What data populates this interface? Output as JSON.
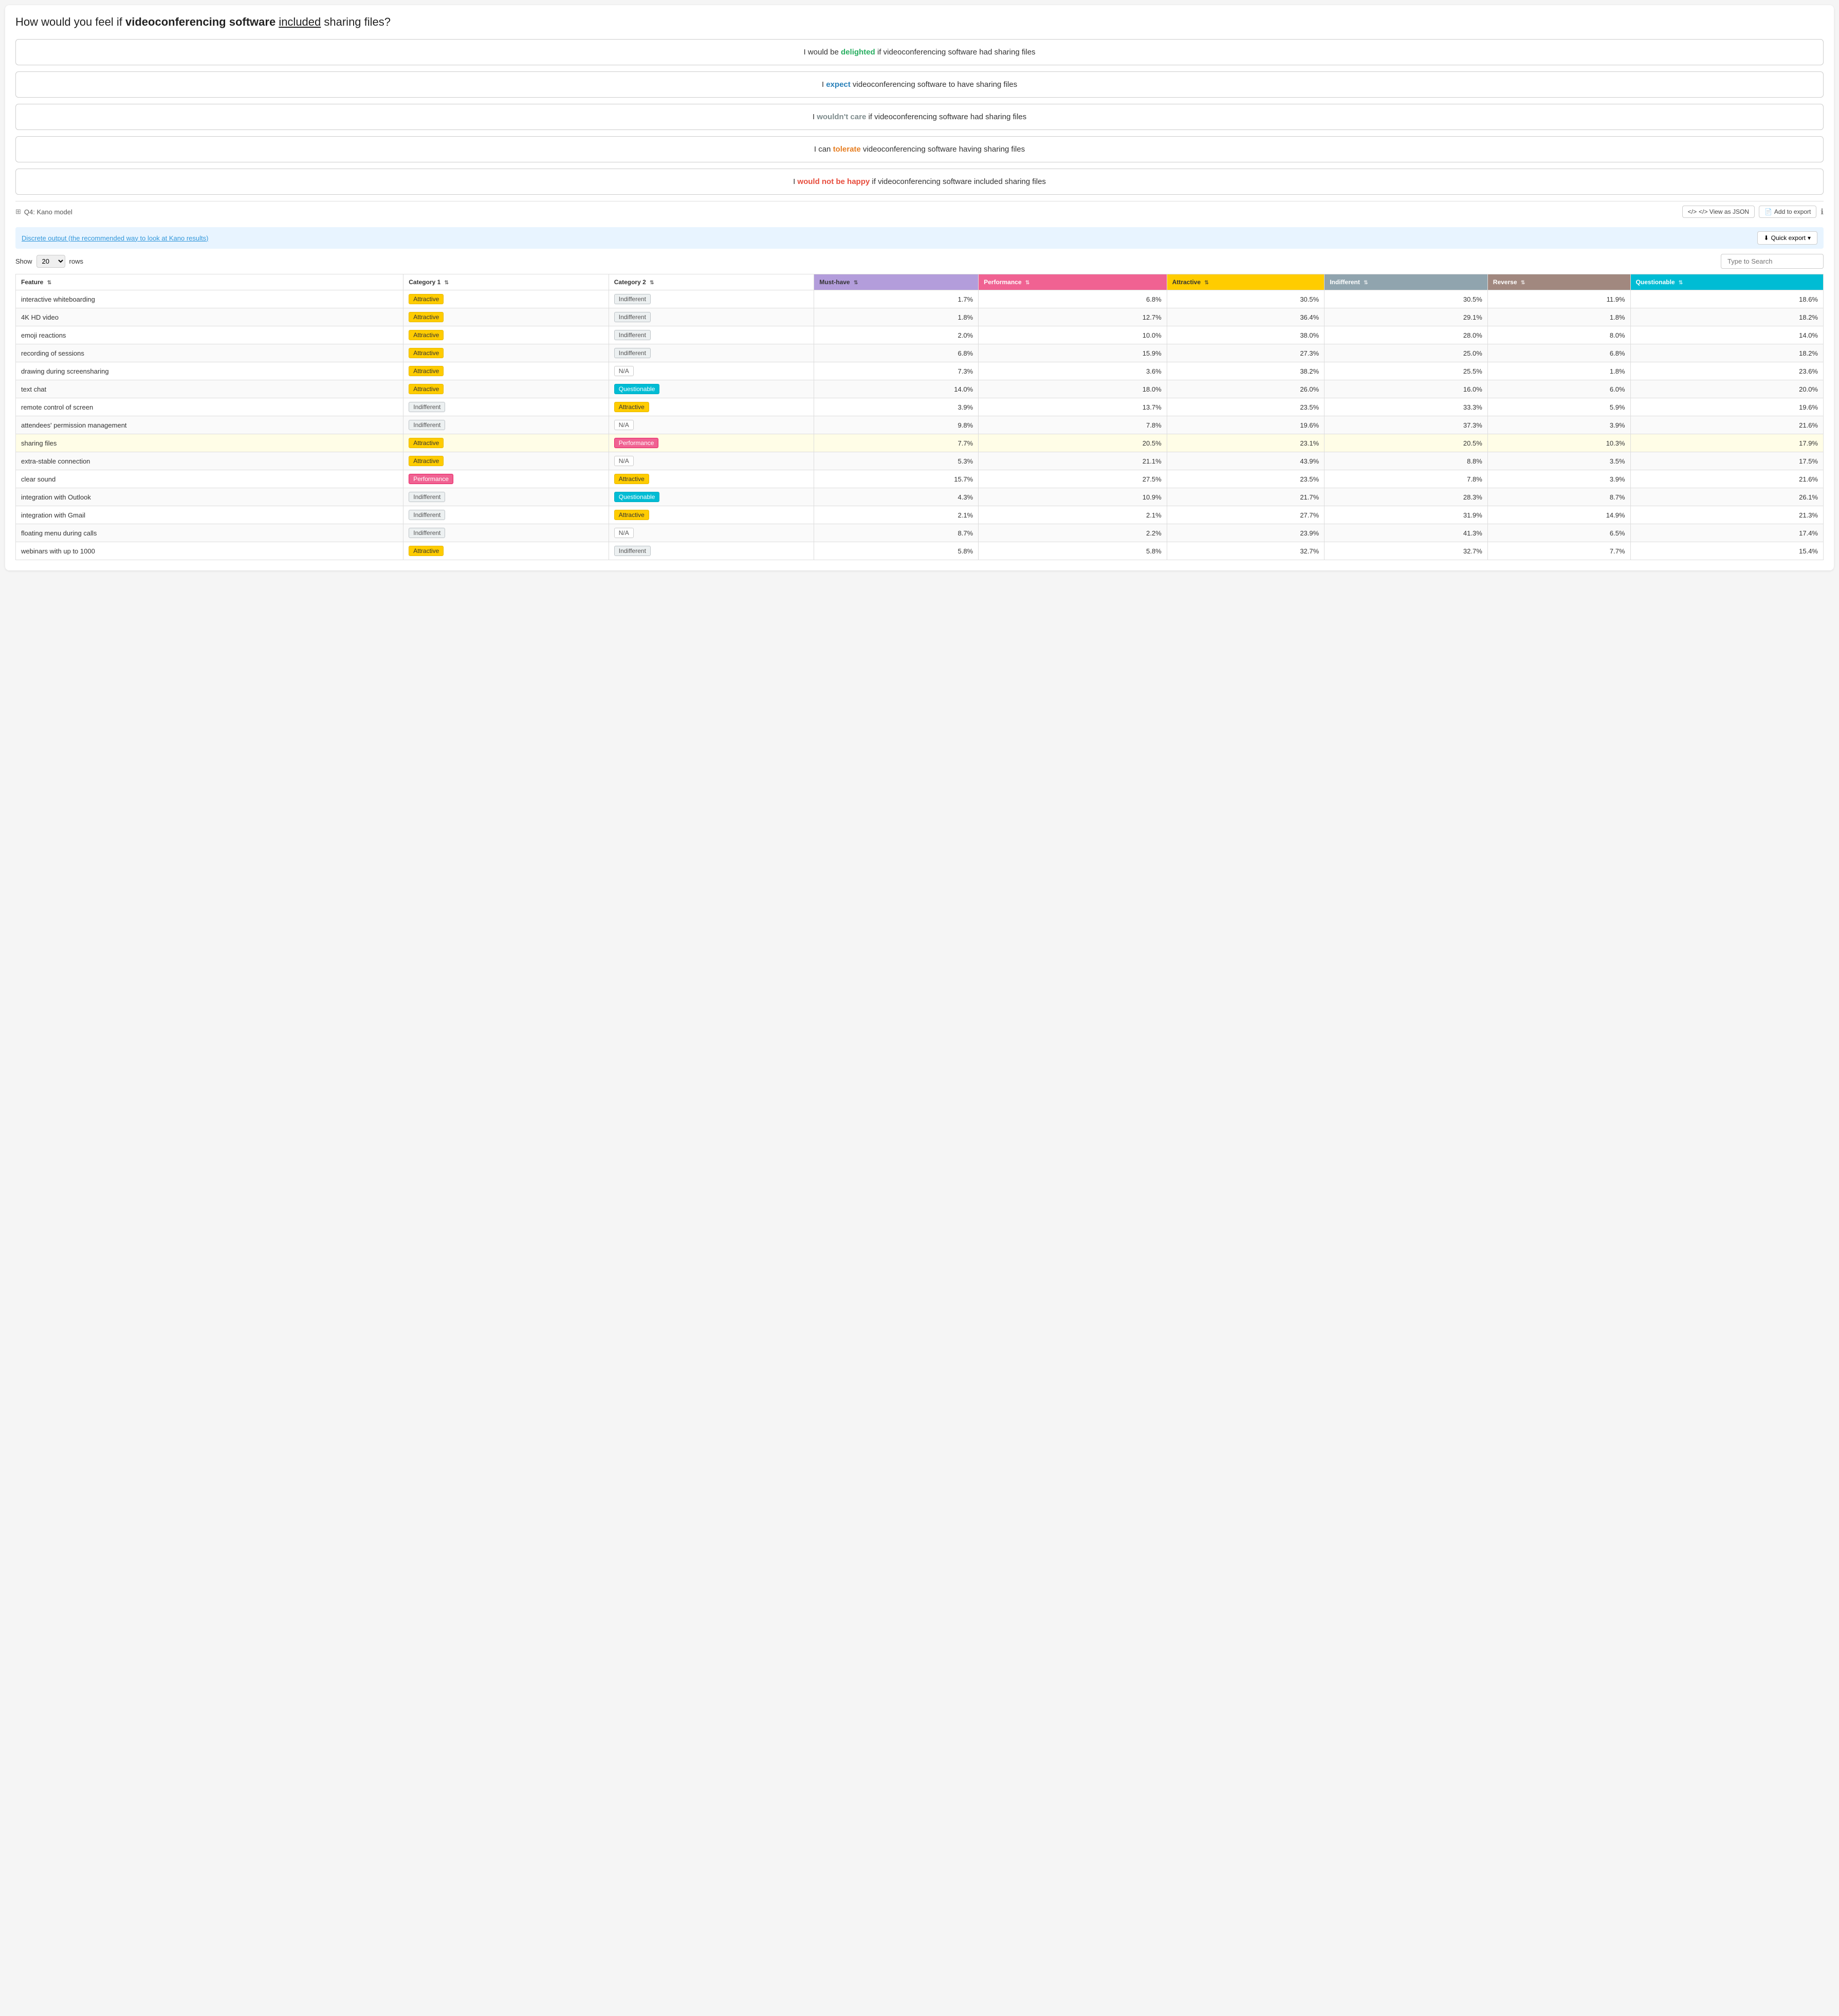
{
  "question": {
    "text_before": "How would you feel if ",
    "bold_part": "videoconferencing software",
    "middle": " ",
    "underlined": "included",
    "after": " sharing files?"
  },
  "answers": [
    {
      "id": "delighted",
      "text_before": "I would be ",
      "colored": "delighted",
      "color_class": "color-green",
      "text_after": " if videoconferencing software had sharing files"
    },
    {
      "id": "expect",
      "text_before": "I ",
      "colored": "expect",
      "color_class": "color-blue",
      "text_after": " videoconferencing software to have sharing files"
    },
    {
      "id": "wouldnt_care",
      "text_before": "I ",
      "colored": "wouldn't care",
      "color_class": "color-gray",
      "text_after": " if videoconferencing software had sharing files"
    },
    {
      "id": "tolerate",
      "text_before": "I can ",
      "colored": "tolerate",
      "color_class": "color-orange",
      "text_after": " videoconferencing software having sharing files"
    },
    {
      "id": "not_happy",
      "text_before": "I ",
      "colored": "would not be happy",
      "color_class": "color-red",
      "text_after": " if videoconferencing software included sharing files"
    }
  ],
  "kano_section": {
    "title": "Q4: Kano model",
    "view_json_label": "</> View as JSON",
    "add_export_label": "Add to export",
    "info_icon": "ℹ",
    "discrete_text": "Discrete output (the recommended way to look at Kano results)",
    "quick_export_label": "⬇ Quick export ▾"
  },
  "table_controls": {
    "show_label": "Show",
    "rows_label": "rows",
    "show_value": "20",
    "search_placeholder": "Type to Search"
  },
  "table": {
    "headers": [
      {
        "id": "feature",
        "label": "Feature",
        "class": "th-feature",
        "sortable": true
      },
      {
        "id": "cat1",
        "label": "Category 1",
        "class": "th-cat1",
        "sortable": true
      },
      {
        "id": "cat2",
        "label": "Category 2",
        "class": "th-cat2",
        "sortable": true
      },
      {
        "id": "must",
        "label": "Must-have",
        "class": "th-must",
        "sortable": true
      },
      {
        "id": "perf",
        "label": "Performance",
        "class": "th-perf",
        "sortable": true
      },
      {
        "id": "attr",
        "label": "Attractive",
        "class": "th-attr",
        "sortable": true
      },
      {
        "id": "indf",
        "label": "Indifferent",
        "class": "th-indf",
        "sortable": true
      },
      {
        "id": "rev",
        "label": "Reverse",
        "class": "th-rev",
        "sortable": true
      },
      {
        "id": "quest",
        "label": "Questionable",
        "class": "th-quest",
        "sortable": true
      }
    ],
    "rows": [
      {
        "feature": "interactive whiteboarding",
        "cat1": "Attractive",
        "cat1_class": "badge-attractive",
        "cat2": "Indifferent",
        "cat2_class": "badge-indifferent",
        "must": "1.7%",
        "perf": "6.8%",
        "attr": "30.5%",
        "indf": "30.5%",
        "rev": "11.9%",
        "quest": "18.6%",
        "highlight": false
      },
      {
        "feature": "4K HD video",
        "cat1": "Attractive",
        "cat1_class": "badge-attractive",
        "cat2": "Indifferent",
        "cat2_class": "badge-indifferent",
        "must": "1.8%",
        "perf": "12.7%",
        "attr": "36.4%",
        "indf": "29.1%",
        "rev": "1.8%",
        "quest": "18.2%",
        "highlight": false
      },
      {
        "feature": "emoji reactions",
        "cat1": "Attractive",
        "cat1_class": "badge-attractive",
        "cat2": "Indifferent",
        "cat2_class": "badge-indifferent",
        "must": "2.0%",
        "perf": "10.0%",
        "attr": "38.0%",
        "indf": "28.0%",
        "rev": "8.0%",
        "quest": "14.0%",
        "highlight": false
      },
      {
        "feature": "recording of sessions",
        "cat1": "Attractive",
        "cat1_class": "badge-attractive",
        "cat2": "Indifferent",
        "cat2_class": "badge-indifferent",
        "must": "6.8%",
        "perf": "15.9%",
        "attr": "27.3%",
        "indf": "25.0%",
        "rev": "6.8%",
        "quest": "18.2%",
        "highlight": false
      },
      {
        "feature": "drawing during screensharing",
        "cat1": "Attractive",
        "cat1_class": "badge-attractive",
        "cat2": "N/A",
        "cat2_class": "badge-na",
        "must": "7.3%",
        "perf": "3.6%",
        "attr": "38.2%",
        "indf": "25.5%",
        "rev": "1.8%",
        "quest": "23.6%",
        "highlight": false
      },
      {
        "feature": "text chat",
        "cat1": "Attractive",
        "cat1_class": "badge-attractive",
        "cat2": "Questionable",
        "cat2_class": "badge-questionable",
        "must": "14.0%",
        "perf": "18.0%",
        "attr": "26.0%",
        "indf": "16.0%",
        "rev": "6.0%",
        "quest": "20.0%",
        "highlight": false
      },
      {
        "feature": "remote control of screen",
        "cat1": "Indifferent",
        "cat1_class": "badge-indifferent",
        "cat2": "Attractive",
        "cat2_class": "badge-attractive",
        "must": "3.9%",
        "perf": "13.7%",
        "attr": "23.5%",
        "indf": "33.3%",
        "rev": "5.9%",
        "quest": "19.6%",
        "highlight": false
      },
      {
        "feature": "attendees' permission management",
        "cat1": "Indifferent",
        "cat1_class": "badge-indifferent",
        "cat2": "N/A",
        "cat2_class": "badge-na",
        "must": "9.8%",
        "perf": "7.8%",
        "attr": "19.6%",
        "indf": "37.3%",
        "rev": "3.9%",
        "quest": "21.6%",
        "highlight": false
      },
      {
        "feature": "sharing files",
        "cat1": "Attractive",
        "cat1_class": "badge-attractive",
        "cat2": "Performance",
        "cat2_class": "badge-performance",
        "must": "7.7%",
        "perf": "20.5%",
        "attr": "23.1%",
        "indf": "20.5%",
        "rev": "10.3%",
        "quest": "17.9%",
        "highlight": true
      },
      {
        "feature": "extra-stable connection",
        "cat1": "Attractive",
        "cat1_class": "badge-attractive",
        "cat2": "N/A",
        "cat2_class": "badge-na",
        "must": "5.3%",
        "perf": "21.1%",
        "attr": "43.9%",
        "indf": "8.8%",
        "rev": "3.5%",
        "quest": "17.5%",
        "highlight": false
      },
      {
        "feature": "clear sound",
        "cat1": "Performance",
        "cat1_class": "badge-performance",
        "cat2": "Attractive",
        "cat2_class": "badge-attractive",
        "must": "15.7%",
        "perf": "27.5%",
        "attr": "23.5%",
        "indf": "7.8%",
        "rev": "3.9%",
        "quest": "21.6%",
        "highlight": false
      },
      {
        "feature": "integration with Outlook",
        "cat1": "Indifferent",
        "cat1_class": "badge-indifferent",
        "cat2": "Questionable",
        "cat2_class": "badge-questionable",
        "must": "4.3%",
        "perf": "10.9%",
        "attr": "21.7%",
        "indf": "28.3%",
        "rev": "8.7%",
        "quest": "26.1%",
        "highlight": false
      },
      {
        "feature": "integration with Gmail",
        "cat1": "Indifferent",
        "cat1_class": "badge-indifferent",
        "cat2": "Attractive",
        "cat2_class": "badge-attractive",
        "must": "2.1%",
        "perf": "2.1%",
        "attr": "27.7%",
        "indf": "31.9%",
        "rev": "14.9%",
        "quest": "21.3%",
        "highlight": false
      },
      {
        "feature": "floating menu during calls",
        "cat1": "Indifferent",
        "cat1_class": "badge-indifferent",
        "cat2": "N/A",
        "cat2_class": "badge-na",
        "must": "8.7%",
        "perf": "2.2%",
        "attr": "23.9%",
        "indf": "41.3%",
        "rev": "6.5%",
        "quest": "17.4%",
        "highlight": false
      },
      {
        "feature": "webinars with up to 1000",
        "cat1": "Attractive",
        "cat1_class": "badge-attractive",
        "cat2": "Indifferent",
        "cat2_class": "badge-indifferent",
        "must": "5.8%",
        "perf": "5.8%",
        "attr": "32.7%",
        "indf": "32.7%",
        "rev": "7.7%",
        "quest": "15.4%",
        "highlight": false
      }
    ]
  }
}
